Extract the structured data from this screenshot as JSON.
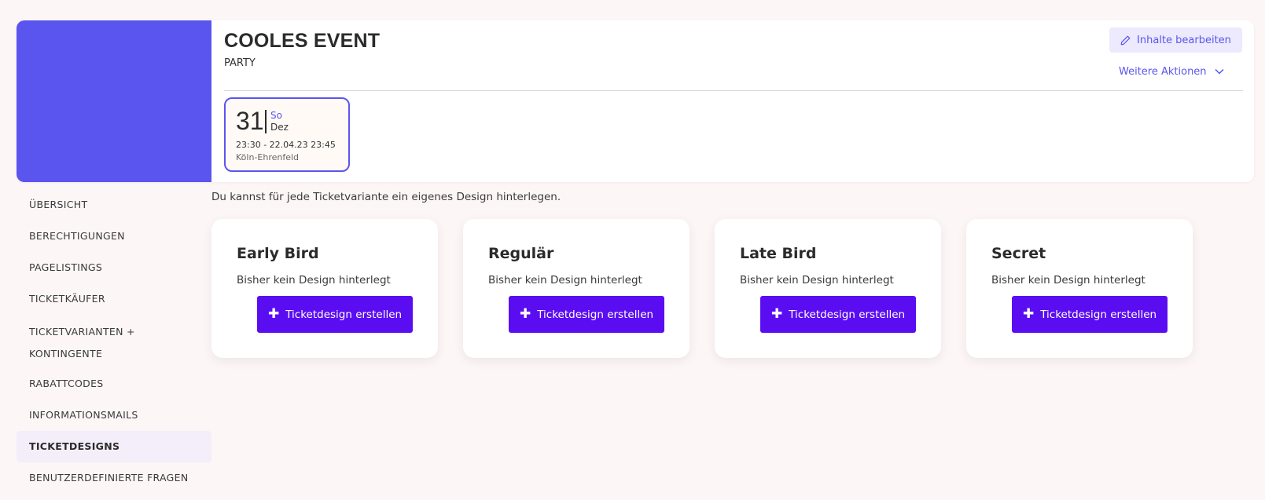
{
  "event": {
    "title": "COOLES EVENT",
    "subtitle": "PARTY",
    "cover_color": "#5a55ef",
    "edit_label": "Inhalte bearbeiten",
    "more_actions_label": "Weitere Aktionen",
    "date": {
      "day": "31",
      "weekday": "So",
      "month": "Dez",
      "time_range": "23:30 - 22.04.23 23:45",
      "location": "Köln-Ehrenfeld"
    }
  },
  "sidebar": {
    "items": [
      {
        "label": "ÜBERSICHT",
        "active": false
      },
      {
        "label": "BERECHTIGUNGEN",
        "active": false
      },
      {
        "label": "PAGELISTINGS",
        "active": false
      },
      {
        "label": "TICKETKÄUFER",
        "active": false
      },
      {
        "label": "TICKETVARIANTEN +",
        "label2": "KONTINGENTE",
        "active": false
      },
      {
        "label": "RABATTCODES",
        "active": false
      },
      {
        "label": "INFORMATIONSMAILS",
        "active": false
      },
      {
        "label": "TICKETDESIGNS",
        "active": true
      },
      {
        "label": "BENUTZERDEFINIERTE FRAGEN",
        "active": false
      }
    ]
  },
  "main": {
    "intro": "Du kannst für jede Ticketvariante ein eigenes Design hinterlegen.",
    "cards": [
      {
        "title": "Early Bird",
        "description": "Bisher kein Design hinterlegt",
        "button_label": "Ticketdesign erstellen"
      },
      {
        "title": "Regulär",
        "description": "Bisher kein Design hinterlegt",
        "button_label": "Ticketdesign erstellen"
      },
      {
        "title": "Late Bird",
        "description": "Bisher kein Design hinterlegt",
        "button_label": "Ticketdesign erstellen"
      },
      {
        "title": "Secret",
        "description": "Bisher kein Design hinterlegt",
        "button_label": "Ticketdesign erstellen"
      }
    ]
  },
  "colors": {
    "accent": "#5a55ef",
    "button": "#5b0df2",
    "background": "#fdf6f7"
  }
}
